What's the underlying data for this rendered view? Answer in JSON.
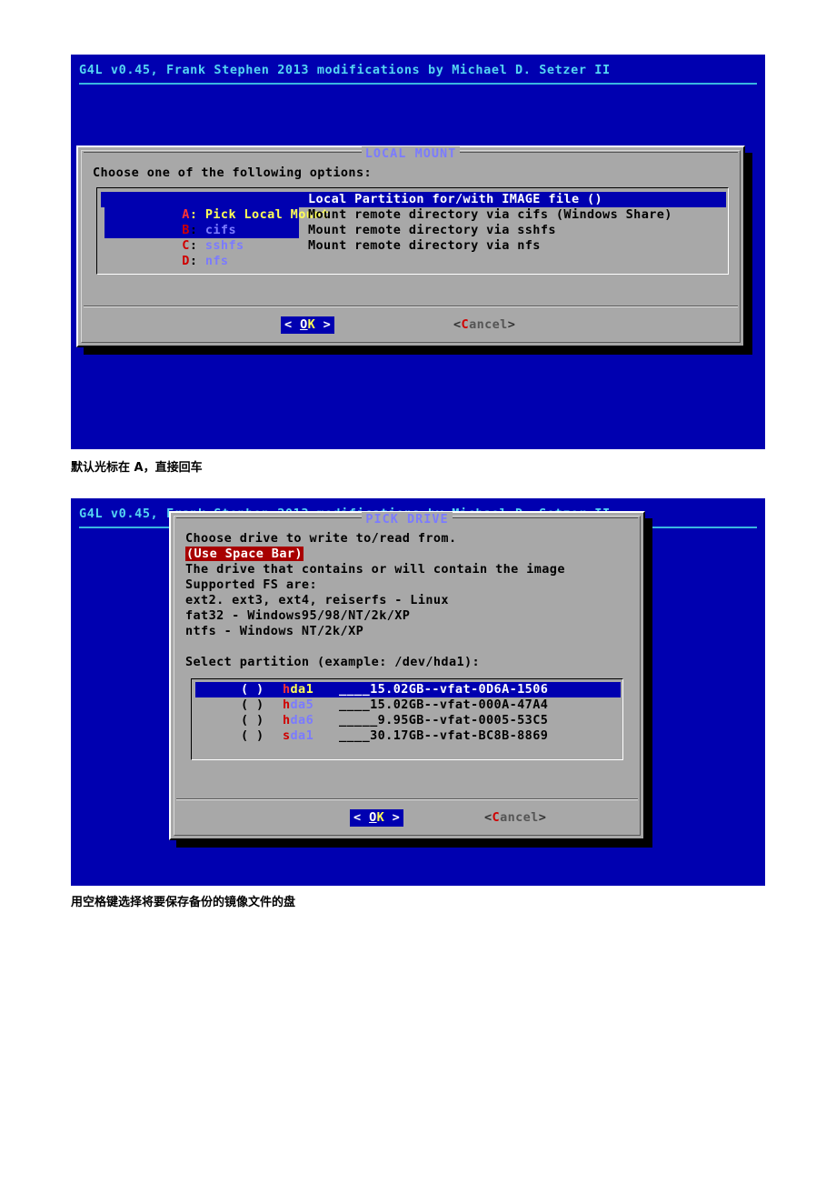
{
  "document": {
    "captions": [
      "默认光标在 A，直接回车",
      "用空格键选择将要保存备份的镜像文件的盘"
    ]
  },
  "colors": {
    "terminal_background": "#0000b0",
    "dialog_background": "#a8a8a8",
    "header_text": "#55d6f2",
    "title_text": "#7b7bff",
    "highlight_background": "#0000b0",
    "highlight_text": "#ffff55",
    "key_letter": "#d00000",
    "banner_background": "#a80000"
  },
  "screens": [
    {
      "header": "G4L v0.45, Frank Stephen 2013 modifications by Michael D. Setzer II",
      "dialog": {
        "title": "LOCAL MOUNT",
        "prompt": "Choose one of the following options:",
        "menu": [
          {
            "key": "A",
            "tag": "Pick Local Mount",
            "label": "A: Pick Local Mount",
            "description": "Local Partition for/with IMAGE file ()",
            "selected": true
          },
          {
            "key": "B",
            "tag": "cifs",
            "label": "B: cifs",
            "description": "Mount remote directory via cifs (Windows Share)",
            "selected": false
          },
          {
            "key": "C",
            "tag": "sshfs",
            "label": "C: sshfs",
            "description": "Mount remote directory via sshfs",
            "selected": false
          },
          {
            "key": "D",
            "tag": "nfs",
            "label": "D: nfs",
            "description": "Mount remote directory via nfs",
            "selected": false
          }
        ],
        "buttons": {
          "ok": {
            "left_bracket": "<",
            "pre": " ",
            "key": "O",
            "rest": "K",
            "post": " ",
            "right_bracket": ">",
            "label": "< OK >",
            "focused": true
          },
          "cancel": {
            "left_bracket": "<",
            "key": "C",
            "rest": "ancel",
            "right_bracket": ">",
            "label": "<Cancel>",
            "focused": false
          }
        }
      }
    },
    {
      "header": "G4L v0.45, Frank Stephen 2013 modifications by Michael D. Setzer II",
      "dialog": {
        "title": "PICK DRIVE",
        "lines": [
          "Choose drive to write to/read from.",
          "(Use Space Bar)",
          "The drive that contains or will contain the image",
          "Supported FS are:",
          "ext2. ext3, ext4, reiserfs - Linux",
          "fat32 - Windows95/98/NT/2k/XP",
          "ntfs - Windows NT/2k/XP",
          "",
          "Select partition (example: /dev/hda1):"
        ],
        "banner_line": "(Use Space Bar)",
        "partitions": [
          {
            "checkbox": "( )",
            "checked": false,
            "name": "hda1",
            "name_key": "h",
            "name_rest": "da1",
            "info": "____15.02GB--vfat-0D6A-1506",
            "size": "15.02GB",
            "fs": "vfat",
            "uuid": "0D6A-1506",
            "selected": true
          },
          {
            "checkbox": "( )",
            "checked": false,
            "name": "hda5",
            "name_key": "h",
            "name_rest": "da5",
            "info": "____15.02GB--vfat-000A-47A4",
            "size": "15.02GB",
            "fs": "vfat",
            "uuid": "000A-47A4",
            "selected": false
          },
          {
            "checkbox": "( )",
            "checked": false,
            "name": "hda6",
            "name_key": "h",
            "name_rest": "da6",
            "info": "_____9.95GB--vfat-0005-53C5",
            "size": "9.95GB",
            "fs": "vfat",
            "uuid": "0005-53C5",
            "selected": false
          },
          {
            "checkbox": "( )",
            "checked": false,
            "name": "sda1",
            "name_key": "s",
            "name_rest": "da1",
            "info": "____30.17GB--vfat-BC8B-8869",
            "size": "30.17GB",
            "fs": "vfat",
            "uuid": "BC8B-8869",
            "selected": false
          }
        ],
        "buttons": {
          "ok": {
            "left_bracket": "<",
            "pre": " ",
            "key": "O",
            "rest": "K",
            "post": " ",
            "right_bracket": ">",
            "label": "< OK >",
            "focused": true
          },
          "cancel": {
            "left_bracket": "<",
            "key": "C",
            "rest": "ancel",
            "right_bracket": ">",
            "label": "<Cancel>",
            "focused": false
          }
        }
      }
    }
  ]
}
